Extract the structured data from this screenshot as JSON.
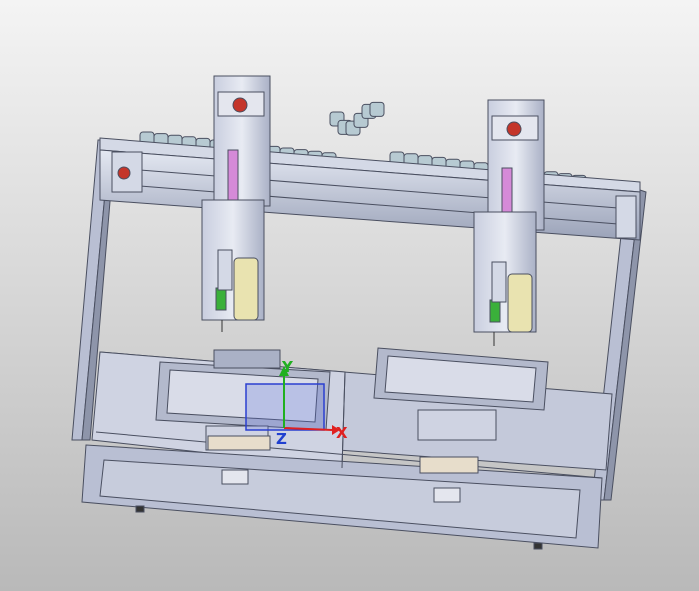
{
  "viewport": {
    "background_top": "#f4f4f4",
    "background_bottom": "#b9b9b9"
  },
  "triad": {
    "x_label": "X",
    "y_label": "Y",
    "z_label": "Z",
    "x_color": "#e02020",
    "y_color": "#20b020",
    "z_color": "#2040d0"
  },
  "colors": {
    "frame": "#b9bfd3",
    "frame_dark": "#8e95aa",
    "panel": "#c4c9da",
    "metal": "#d4d9e6",
    "edge": "#4a4f60",
    "chain": "#b7cad2",
    "cylinder_pink": "#d58ad8",
    "cylinder_green": "#3ab03a",
    "syringe": "#e9e3b0",
    "motor_red": "#c4352a",
    "tan_block": "#e7ddcb"
  }
}
